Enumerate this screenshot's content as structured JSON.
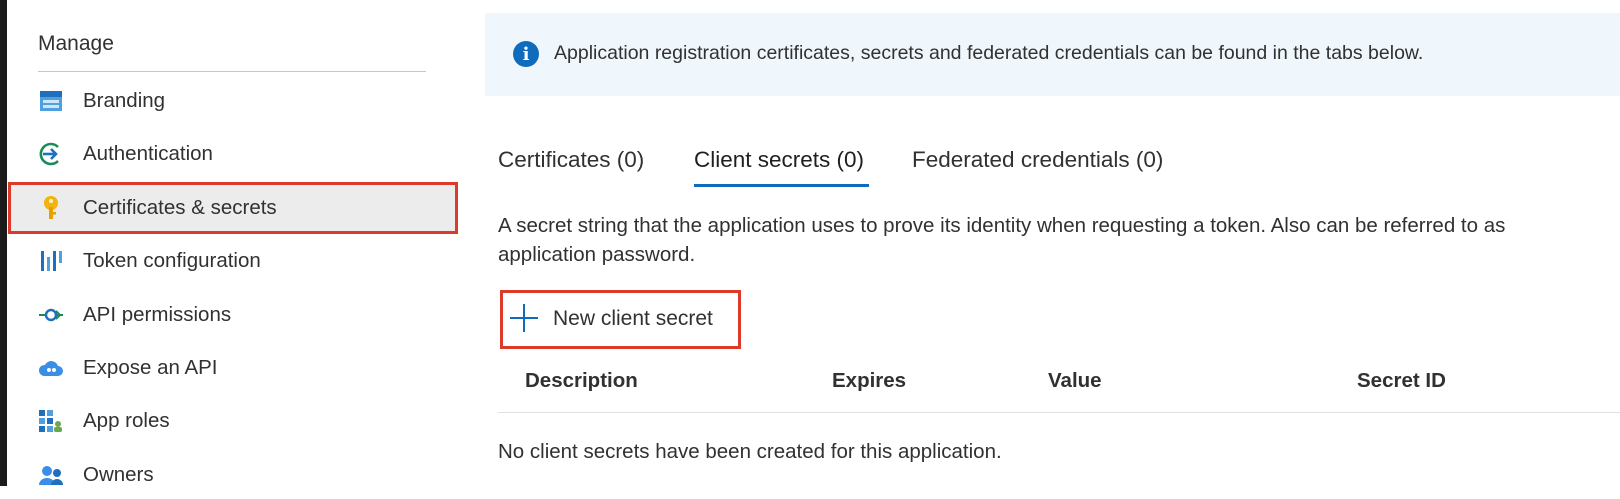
{
  "sidebar": {
    "section_title": "Manage",
    "items": [
      {
        "label": "Branding",
        "icon": "branding-icon"
      },
      {
        "label": "Authentication",
        "icon": "authentication-icon"
      },
      {
        "label": "Certificates & secrets",
        "icon": "key-icon",
        "active": true
      },
      {
        "label": "Token configuration",
        "icon": "token-configuration-icon"
      },
      {
        "label": "API permissions",
        "icon": "api-permissions-icon"
      },
      {
        "label": "Expose an API",
        "icon": "cloud-icon"
      },
      {
        "label": "App roles",
        "icon": "app-roles-icon"
      },
      {
        "label": "Owners",
        "icon": "owners-icon"
      }
    ]
  },
  "banner": {
    "text": "Application registration certificates, secrets and federated credentials can be found in the tabs below."
  },
  "tabs": [
    {
      "label": "Certificates (0)"
    },
    {
      "label": "Client secrets (0)",
      "active": true
    },
    {
      "label": "Federated credentials (0)"
    }
  ],
  "description": "A secret string that the application uses to prove its identity when requesting a token. Also can be referred to as application password.",
  "new_secret_button": {
    "label": "New client secret"
  },
  "table": {
    "columns": [
      "Description",
      "Expires",
      "Value",
      "Secret ID"
    ],
    "empty_message": "No client secrets have been created for this application."
  },
  "colors": {
    "accent": "#0f6cbd",
    "highlight_outline": "#dc3a2b",
    "banner_bg": "#eff6fc"
  }
}
